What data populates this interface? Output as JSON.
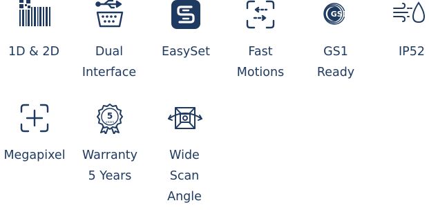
{
  "colors": {
    "primary": "#1f3a60",
    "background": "#ffffff"
  },
  "features": [
    {
      "icon": "barcode-qr-icon",
      "label_lines": [
        "1D & 2D"
      ]
    },
    {
      "icon": "usb-serial-icon",
      "label_lines": [
        "Dual",
        "Interface"
      ]
    },
    {
      "icon": "easyset-icon",
      "label_lines": [
        "EasySet"
      ]
    },
    {
      "icon": "fast-motion-scan-icon",
      "label_lines": [
        "Fast",
        "Motions"
      ]
    },
    {
      "icon": "gs1-logo-icon",
      "icon_text": "GS1",
      "label_lines": [
        "GS1",
        "Ready"
      ]
    },
    {
      "icon": "wind-water-drop-icon",
      "label_lines": [
        "IP52"
      ]
    },
    {
      "icon": "crosshair-frame-icon",
      "label_lines": [
        "Megapixel"
      ]
    },
    {
      "icon": "warranty-badge-icon",
      "icon_text": [
        "5",
        "years"
      ],
      "label_lines": [
        "Warranty",
        "5 Years"
      ]
    },
    {
      "icon": "wide-scan-angle-icon",
      "label_lines": [
        "Wide",
        "Scan",
        "Angle"
      ]
    }
  ]
}
